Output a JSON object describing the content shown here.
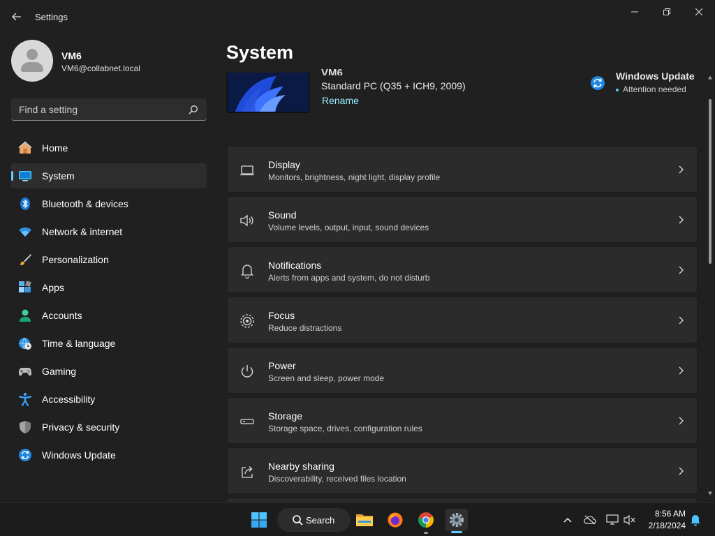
{
  "window": {
    "title": "Settings"
  },
  "user": {
    "name": "VM6",
    "email": "VM6@collabnet.local"
  },
  "search": {
    "placeholder": "Find a setting"
  },
  "sidebar": {
    "items": [
      {
        "label": "Home",
        "icon": "home-icon"
      },
      {
        "label": "System",
        "icon": "system-icon",
        "active": true
      },
      {
        "label": "Bluetooth & devices",
        "icon": "bluetooth-icon"
      },
      {
        "label": "Network & internet",
        "icon": "wifi-icon"
      },
      {
        "label": "Personalization",
        "icon": "brush-icon"
      },
      {
        "label": "Apps",
        "icon": "apps-icon"
      },
      {
        "label": "Accounts",
        "icon": "account-icon"
      },
      {
        "label": "Time & language",
        "icon": "globe-clock-icon"
      },
      {
        "label": "Gaming",
        "icon": "gamepad-icon"
      },
      {
        "label": "Accessibility",
        "icon": "accessibility-icon"
      },
      {
        "label": "Privacy & security",
        "icon": "shield-icon"
      },
      {
        "label": "Windows Update",
        "icon": "update-icon"
      }
    ]
  },
  "main": {
    "title": "System",
    "device": {
      "name_partial": "VM6",
      "model": "Standard PC (Q35 + ICH9, 2009)",
      "rename": "Rename"
    },
    "windows_update": {
      "title": "Windows Update",
      "status": "Attention needed"
    },
    "cards": [
      {
        "title": "Display",
        "subtitle": "Monitors, brightness, night light, display profile",
        "icon": "display-icon"
      },
      {
        "title": "Sound",
        "subtitle": "Volume levels, output, input, sound devices",
        "icon": "speaker-icon"
      },
      {
        "title": "Notifications",
        "subtitle": "Alerts from apps and system, do not disturb",
        "icon": "bell-icon"
      },
      {
        "title": "Focus",
        "subtitle": "Reduce distractions",
        "icon": "focus-icon"
      },
      {
        "title": "Power",
        "subtitle": "Screen and sleep, power mode",
        "icon": "power-icon"
      },
      {
        "title": "Storage",
        "subtitle": "Storage space, drives, configuration rules",
        "icon": "storage-icon"
      },
      {
        "title": "Nearby sharing",
        "subtitle": "Discoverability, received files location",
        "icon": "share-icon"
      }
    ]
  },
  "taskbar": {
    "search_label": "Search",
    "time": "8:56 AM",
    "date": "2/18/2024"
  },
  "colors": {
    "accent": "#60cdff",
    "background": "#202020",
    "card": "#2b2b2b"
  }
}
